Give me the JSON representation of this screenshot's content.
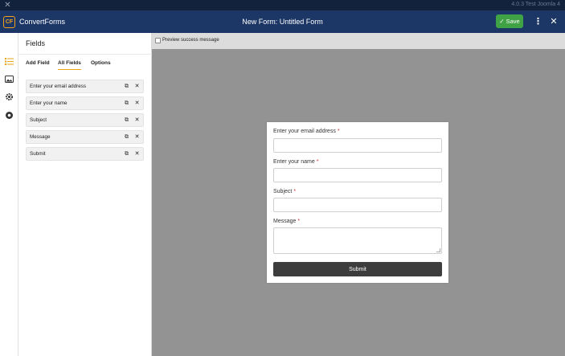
{
  "topstrip": {
    "version": "4.0.3 Test Joomla 4"
  },
  "header": {
    "app_name": "ConvertForms",
    "logo_mark": "CF",
    "title": "New Form: Untitled Form",
    "save_label": "Save"
  },
  "rail": {
    "icons": [
      "list-icon",
      "image-icon",
      "gear-icon",
      "circle-icon"
    ]
  },
  "panel": {
    "title": "Fields",
    "tabs": [
      {
        "label": "Add Field"
      },
      {
        "label": "All Fields"
      },
      {
        "label": "Options"
      }
    ],
    "active_tab": "All Fields",
    "fields": [
      {
        "label": "Enter your email address"
      },
      {
        "label": "Enter your name"
      },
      {
        "label": "Subject"
      },
      {
        "label": "Message"
      },
      {
        "label": "Submit"
      }
    ]
  },
  "canvas": {
    "preview_success_label": "Preview success message"
  },
  "form": {
    "fields": [
      {
        "label": "Enter your email address",
        "required": "*"
      },
      {
        "label": "Enter your name",
        "required": "*"
      },
      {
        "label": "Subject",
        "required": "*"
      },
      {
        "label": "Message",
        "required": "*"
      }
    ],
    "submit_label": "Submit"
  },
  "colors": {
    "header_bg": "#1c3666",
    "accent": "#e8a317",
    "save_green": "#3fa244",
    "submit_dark": "#3d3d3d"
  }
}
